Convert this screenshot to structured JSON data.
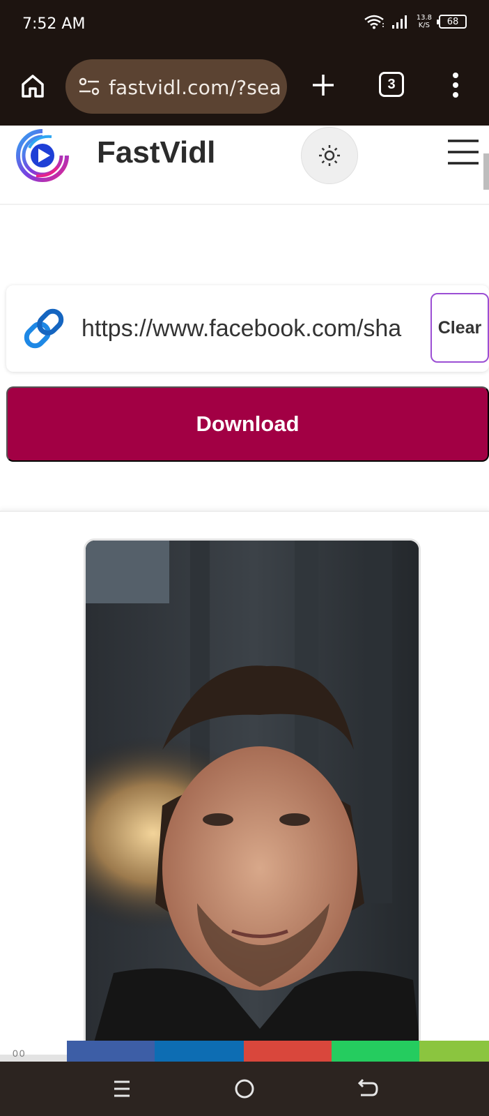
{
  "status_bar": {
    "time": "7:52 AM",
    "net_speed_value": "13.8",
    "net_speed_unit": "K/S",
    "battery": "68"
  },
  "browser": {
    "url": "fastvidl.com/?sea",
    "tab_count": "3"
  },
  "site": {
    "brand": "FastVidl"
  },
  "form": {
    "url_value": "https://www.facebook.com/sha",
    "clear_label": "Clear",
    "download_label": "Download"
  },
  "share_strip": {
    "colors": [
      "#3d5ea6",
      "#0d6db3",
      "#d9473c",
      "#25cc5f",
      "#8bc53f"
    ]
  },
  "footer_fragment": "00",
  "colors": {
    "download_button": "#a20044",
    "clear_border": "#9b4fd4",
    "browser_chrome": "#1d1410",
    "url_pill": "#5b4332"
  }
}
